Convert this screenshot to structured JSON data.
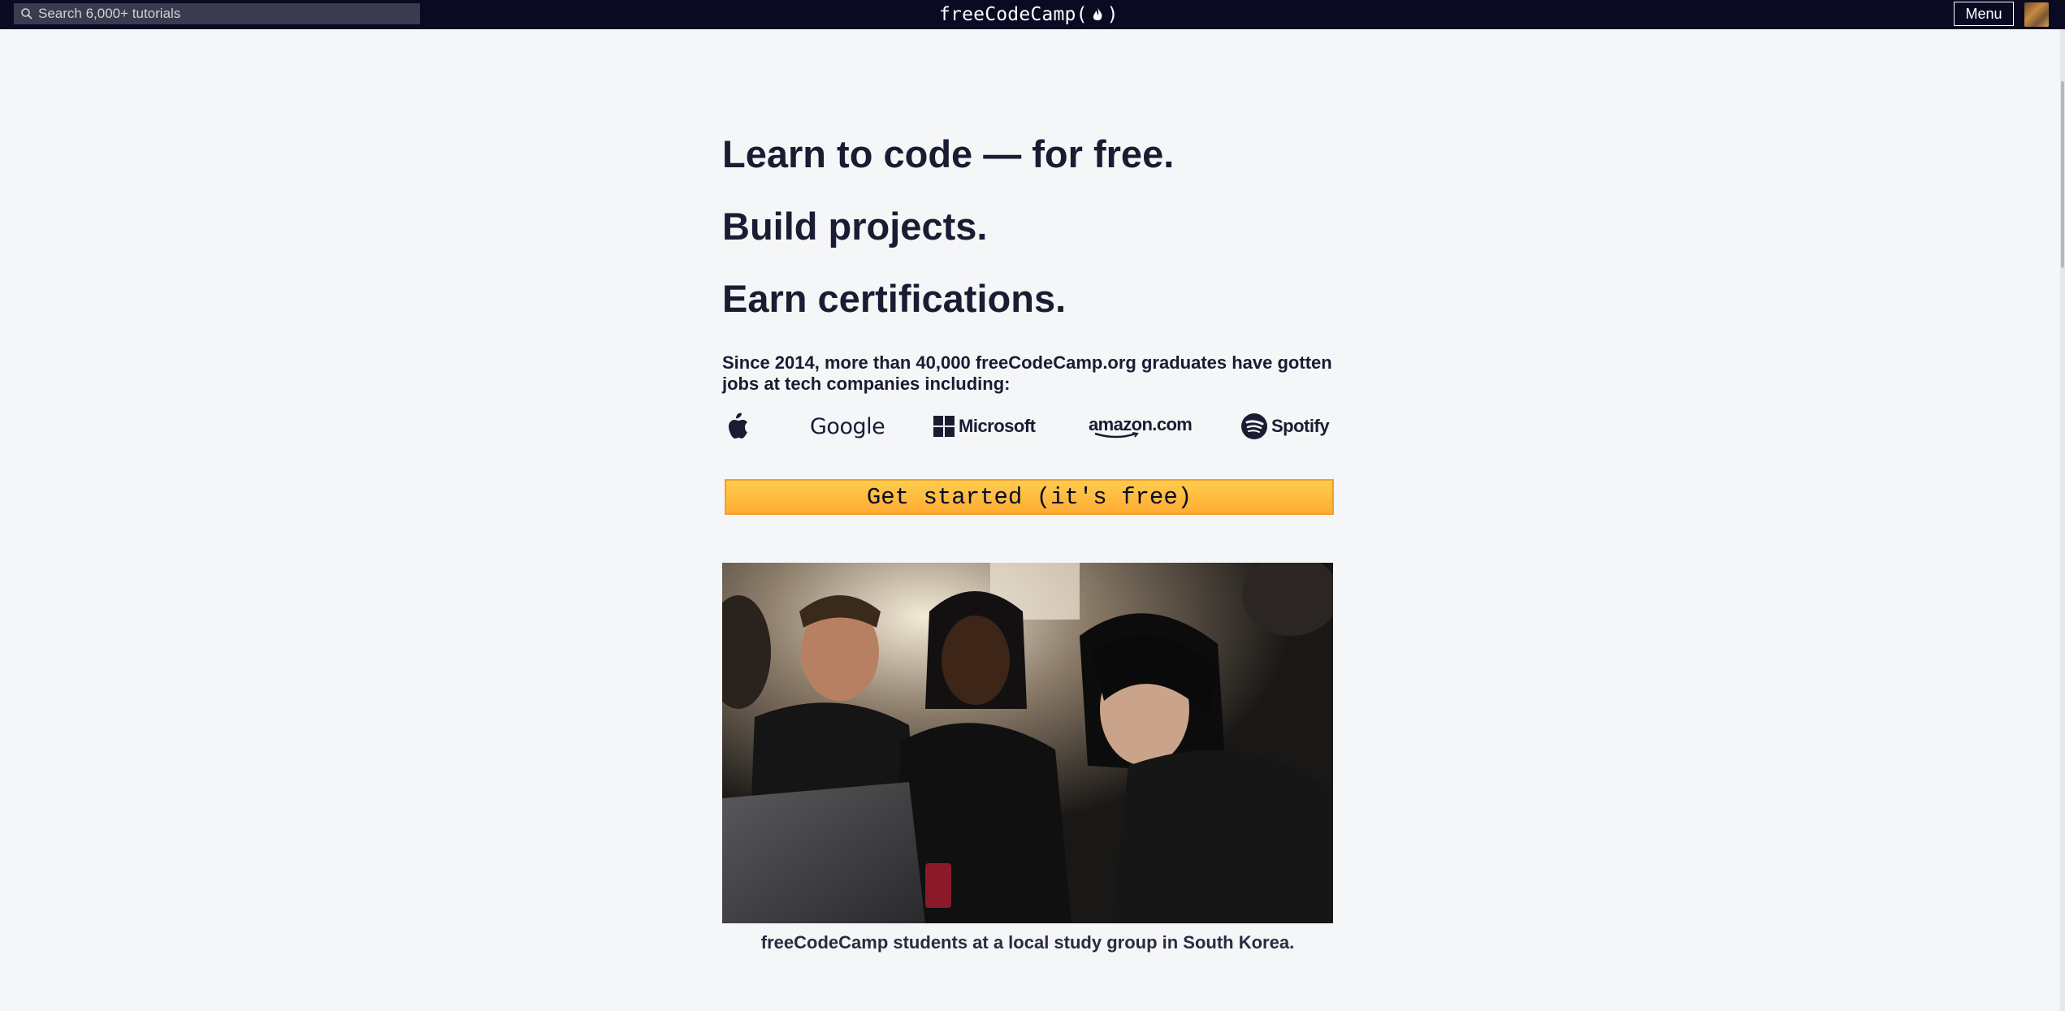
{
  "navbar": {
    "search_placeholder": "Search 6,000+ tutorials",
    "logo_text_left": "freeCodeCamp(",
    "logo_text_right": ")",
    "menu_label": "Menu"
  },
  "hero": {
    "headline_1": "Learn to code — for free.",
    "headline_2": "Build projects.",
    "headline_3": "Earn certifications.",
    "subtitle": "Since 2014, more than 40,000 freeCodeCamp.org graduates have gotten jobs at tech companies including:",
    "companies": {
      "apple": "apple-icon",
      "google": "Google",
      "microsoft": "Microsoft",
      "amazon": "amazon.com",
      "spotify": "Spotify"
    },
    "cta_label": "Get started (it's free)",
    "photo_caption": "freeCodeCamp students at a local study group in South Korea."
  },
  "colors": {
    "navbar_bg": "#0a0a23",
    "page_bg": "#f5f6f7",
    "cta_gradient_top": "#fecc4c",
    "cta_gradient_bottom": "#ffac33",
    "text": "#1b1b32"
  }
}
